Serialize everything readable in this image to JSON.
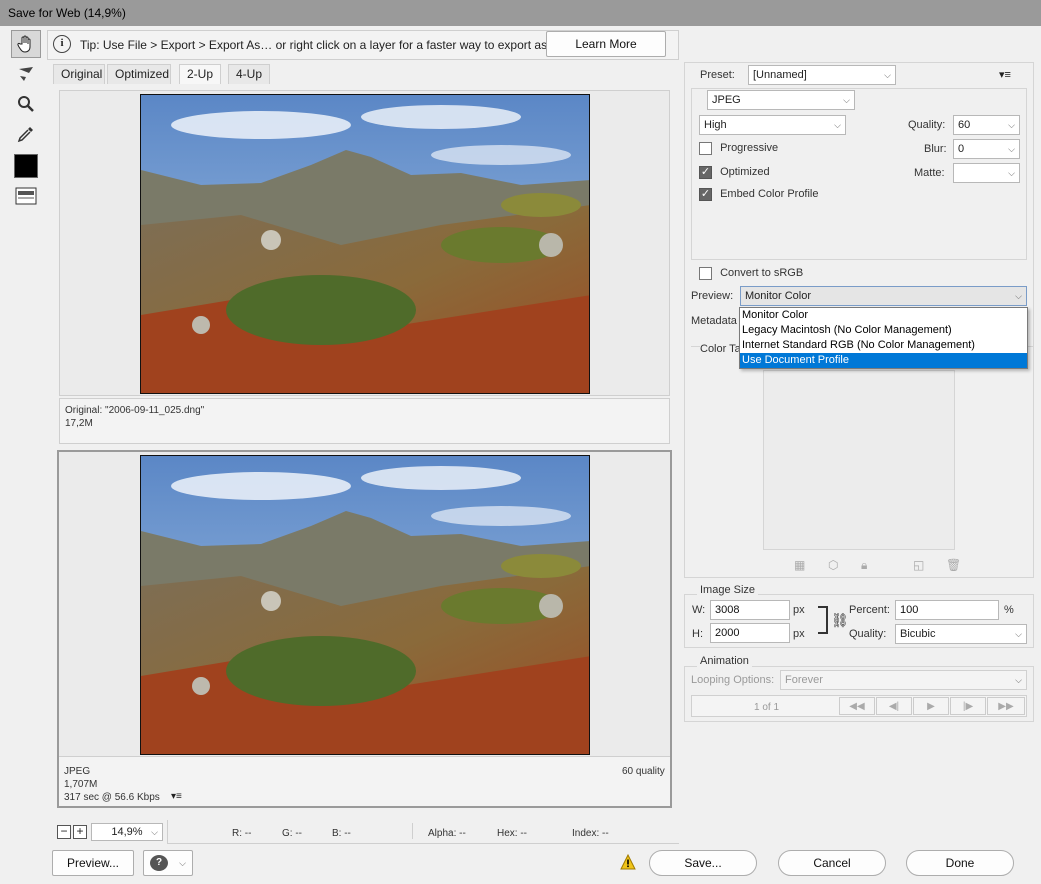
{
  "window": {
    "title": "Save for Web (14,9%)"
  },
  "tip": {
    "text": "Tip: Use File > Export > Export As…  or right click on a layer for a faster way to export assets",
    "learn_more": "Learn More"
  },
  "tabs": [
    {
      "label": "Original"
    },
    {
      "label": "Optimized"
    },
    {
      "label": "2-Up"
    },
    {
      "label": "4-Up"
    }
  ],
  "pane_top": {
    "line1": "Original: \"2006-09-11_025.dng\"",
    "line2": "17,2M"
  },
  "pane_bottom": {
    "format": "JPEG",
    "size": "1,707M",
    "time": "317 sec @ 56.6 Kbps",
    "quality": "60 quality"
  },
  "status": {
    "zoom": "14,9%",
    "r": "R: --",
    "g": "G: --",
    "b": "B: --",
    "alpha": "Alpha: --",
    "hex": "Hex: --",
    "index": "Index: --"
  },
  "preset": {
    "label": "Preset:",
    "value": "[Unnamed]"
  },
  "format": {
    "value": "JPEG"
  },
  "compression": {
    "value": "High"
  },
  "quality": {
    "label": "Quality:",
    "value": "60"
  },
  "blur": {
    "label": "Blur:",
    "value": "0"
  },
  "matte": {
    "label": "Matte:",
    "value": ""
  },
  "options": {
    "progressive": {
      "label": "Progressive",
      "checked": false
    },
    "optimized": {
      "label": "Optimized",
      "checked": true
    },
    "embed": {
      "label": "Embed Color Profile",
      "checked": true
    },
    "srgb": {
      "label": "Convert to sRGB",
      "checked": false
    }
  },
  "preview": {
    "label": "Preview:",
    "value": "Monitor Color",
    "options": [
      "Monitor Color",
      "Legacy Macintosh (No Color Management)",
      "Internet Standard RGB (No Color Management)",
      "Use Document Profile"
    ],
    "highlighted": "Use Document Profile"
  },
  "metadata": {
    "label": "Metadata"
  },
  "color_table": {
    "label": "Color Ta"
  },
  "image_size": {
    "title": "Image Size",
    "w_label": "W:",
    "w_value": "3008",
    "h_label": "H:",
    "h_value": "2000",
    "unit": "px",
    "percent_label": "Percent:",
    "percent_value": "100",
    "percent_unit": "%",
    "quality_label": "Quality:",
    "quality_value": "Bicubic"
  },
  "animation": {
    "title": "Animation",
    "looping_label": "Looping Options:",
    "looping_value": "Forever",
    "frame": "1 of 1"
  },
  "footer": {
    "preview_btn": "Preview...",
    "save_btn": "Save...",
    "cancel_btn": "Cancel",
    "done_btn": "Done"
  },
  "colors": {
    "accent": "#0078d7",
    "warning": "#f0c419"
  }
}
